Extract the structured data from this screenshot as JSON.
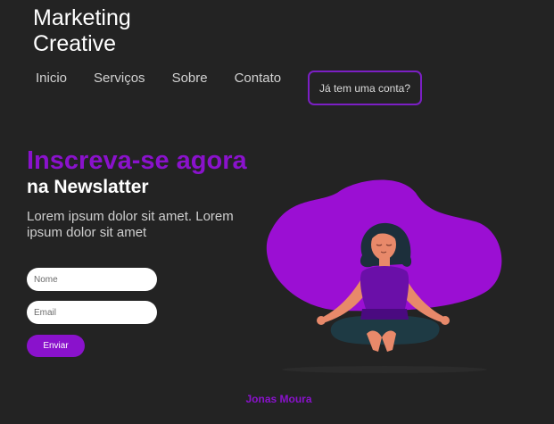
{
  "brand": {
    "line1": "Marketing",
    "line2": "Creative"
  },
  "nav": {
    "items": [
      "Inicio",
      "Serviços",
      "Sobre",
      "Contato"
    ]
  },
  "login_button": "Já tem uma conta?",
  "hero": {
    "headline": "Inscreva-se agora",
    "subheadline": "na Newslatter",
    "description": "Lorem ipsum dolor sit amet. Lorem ipsum dolor sit amet"
  },
  "form": {
    "name_placeholder": "Nome",
    "email_placeholder": "Email",
    "submit_label": "Enviar"
  },
  "illustration": {
    "icon": "meditating-woman-icon"
  },
  "footer": {
    "author": "Jonas Moura"
  },
  "colors": {
    "background": "#232323",
    "accent": "#8a12cc",
    "blob": "#9b0fd3",
    "text": "#ffffff"
  }
}
